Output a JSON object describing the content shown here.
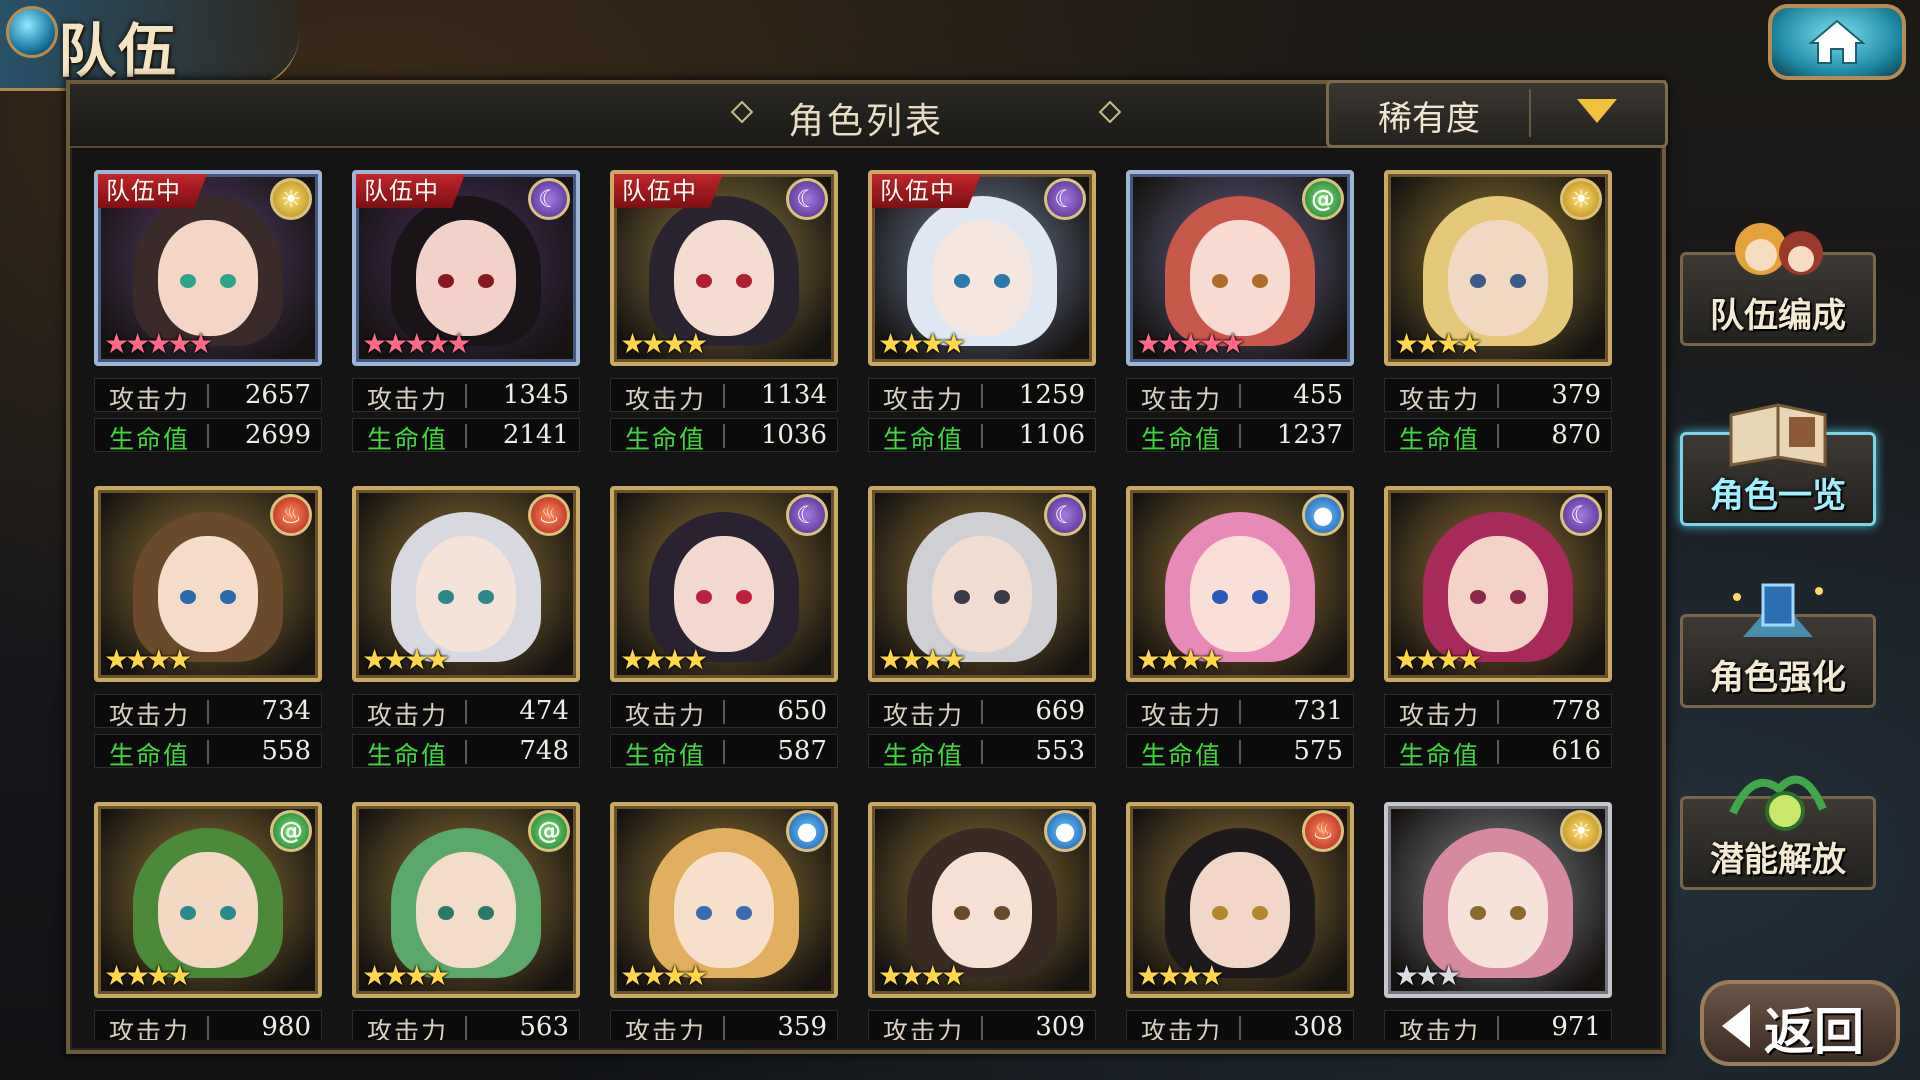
{
  "header": {
    "title": "队伍"
  },
  "panel": {
    "title": "角色列表",
    "sort_label": "稀有度"
  },
  "labels": {
    "atk": "攻击力",
    "hp": "生命值",
    "team_tag": "队伍中"
  },
  "side_menu": [
    {
      "label": "队伍编成"
    },
    {
      "label": "角色一览",
      "active": true
    },
    {
      "label": "角色强化"
    },
    {
      "label": "潜能解放"
    }
  ],
  "back_label": "返回",
  "characters": [
    {
      "in_team": true,
      "element": "sun-icon",
      "stars": 5,
      "atk": "2657",
      "hp": "2699"
    },
    {
      "in_team": true,
      "element": "moon-icon",
      "stars": 5,
      "atk": "1345",
      "hp": "2141"
    },
    {
      "in_team": true,
      "element": "moon-icon",
      "stars": 4,
      "atk": "1134",
      "hp": "1036"
    },
    {
      "in_team": true,
      "element": "moon-icon",
      "stars": 4,
      "atk": "1259",
      "hp": "1106"
    },
    {
      "in_team": false,
      "element": "wind-icon",
      "stars": 5,
      "atk": "455",
      "hp": "1237"
    },
    {
      "in_team": false,
      "element": "sun-icon",
      "stars": 4,
      "atk": "379",
      "hp": "870"
    },
    {
      "in_team": false,
      "element": "fire-icon",
      "stars": 4,
      "atk": "734",
      "hp": "558"
    },
    {
      "in_team": false,
      "element": "fire-icon",
      "stars": 4,
      "atk": "474",
      "hp": "748"
    },
    {
      "in_team": false,
      "element": "moon-icon",
      "stars": 4,
      "atk": "650",
      "hp": "587"
    },
    {
      "in_team": false,
      "element": "moon-icon",
      "stars": 4,
      "atk": "669",
      "hp": "553"
    },
    {
      "in_team": false,
      "element": "water-icon",
      "stars": 4,
      "atk": "731",
      "hp": "575"
    },
    {
      "in_team": false,
      "element": "moon-icon",
      "stars": 4,
      "atk": "778",
      "hp": "616"
    },
    {
      "in_team": false,
      "element": "wind-icon",
      "stars": 4,
      "atk": "980",
      "hp": ""
    },
    {
      "in_team": false,
      "element": "wind-icon",
      "stars": 4,
      "atk": "563",
      "hp": ""
    },
    {
      "in_team": false,
      "element": "water-icon",
      "stars": 4,
      "atk": "359",
      "hp": ""
    },
    {
      "in_team": false,
      "element": "water-icon",
      "stars": 4,
      "atk": "309",
      "hp": ""
    },
    {
      "in_team": false,
      "element": "fire-icon",
      "stars": 4,
      "atk": "308",
      "hp": ""
    },
    {
      "in_team": false,
      "element": "sun-icon",
      "stars": 3,
      "atk": "971",
      "hp": ""
    }
  ]
}
